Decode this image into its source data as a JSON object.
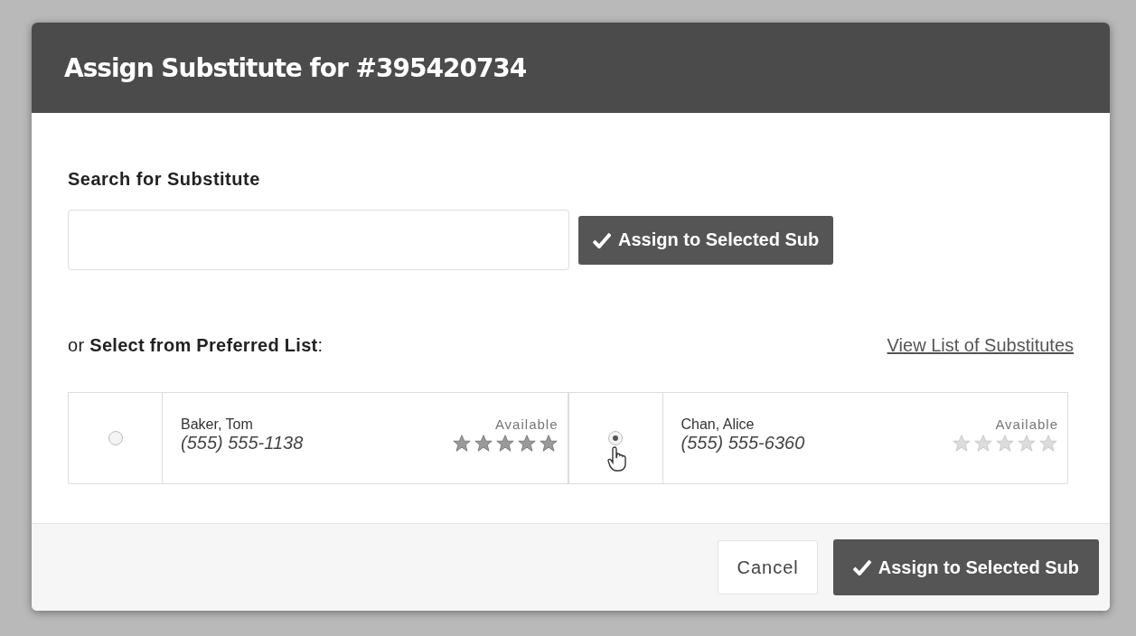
{
  "dialog": {
    "title": "Assign Substitute for #395420734"
  },
  "search": {
    "label": "Search for Substitute",
    "assign_button": "Assign to Selected Sub"
  },
  "preferred": {
    "heading": "or **Select from Preferred List**:",
    "link": "View List of Substitutes"
  },
  "substitutes": [
    {
      "name": "Baker, Tom",
      "phone": "(555) 555-1138",
      "status": "Available",
      "stars": 5,
      "selected": false
    },
    {
      "name": "Chan, Alice",
      "phone": "(555) 555-6360",
      "status": "Available",
      "stars": 0,
      "selected": true
    }
  ],
  "footer": {
    "cancel": "Cancel",
    "assign": "Assign to Selected Sub"
  }
}
